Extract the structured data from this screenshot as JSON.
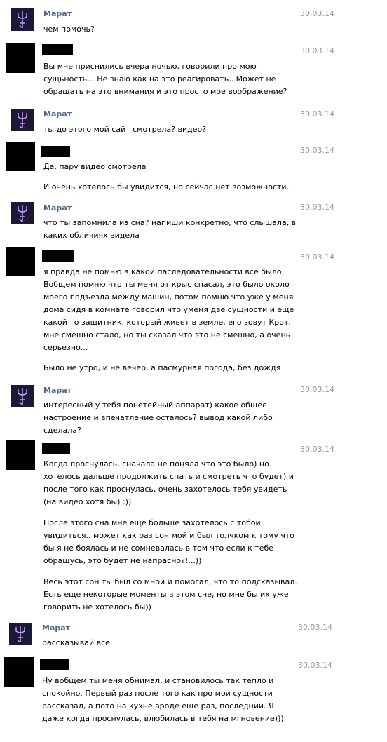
{
  "messages": [
    {
      "author": "Марат",
      "date": "30.03.14",
      "paragraphs": [
        "чем помочь?"
      ]
    },
    {
      "author": "",
      "date": "30.03.14",
      "paragraphs": [
        "Вы мне приснились вчера ночью, говорили про мою\nсущьность... Не знаю как на это реагировать.. Может не\nобращать на это внимания и это просто мое воображение?"
      ]
    },
    {
      "author": "Марат",
      "date": "30.03.14",
      "paragraphs": [
        "ты до этого мой сайт смотрела? видео?"
      ]
    },
    {
      "author": "",
      "date": "30.03.14",
      "paragraphs": [
        "Да, пару видео смотрела",
        "И очень хотелось бы увидится, но сейчас нет возможности.."
      ]
    },
    {
      "author": "Марат",
      "date": "30.03.14",
      "paragraphs": [
        "что ты запомнила из сна? напиши конкретно, что слышала, в\nкаких обличиях видела"
      ]
    },
    {
      "author": "",
      "date": "30.03.14",
      "paragraphs": [
        "я правда не помню в какой паследовательности все было.\nВобщем помню что ты меня от крыс спасал, это было около\nмоего подъезда между машин, потом помню что уже у меня\nдома сидя в комнате говорил что уменя две сущности и еще\nкакой то защитник, который живет в земле, его зовут Крот,\nмне смешно стало, но ты сказал что это не смешно, а очень\nсерьезно...",
        "Было не утро, и не вечер, а пасмурная погода, без дождя"
      ]
    },
    {
      "author": "Марат",
      "date": "30.03.14",
      "paragraphs": [
        "интересный у тебя понетейный аппарат) какое общее\nнастроение и впечатление осталось? вывод какой либо\nсделала?"
      ]
    },
    {
      "author": "",
      "date": "30.03.14",
      "paragraphs": [
        "Когда проснулась, сначала не поняла что это было) но\nхотелось дальше продолжить спать и смотреть что будет) и\nпосле того как проснулась, очень захотелось тебя увидеть\n(на видео хотя бы) :))",
        "После этого сна мне еще больше захотелось с тобой\nувидиться.. может как раз сон мой и был толчком к тому что\nбы я не боялась и не сомневалась в том что если к тебе\nобращусь, это будет не напрасно?!...))",
        "Весь этот сон ты был со мной и помогал, что то подсказывал.\nЕсть еще некоторые моменты в этом сне, но мне бы их уже\nговорить не хотелось бы))"
      ]
    },
    {
      "author": "Марат",
      "date": "30.03.14",
      "paragraphs": [
        "рассказывай всё"
      ]
    },
    {
      "author": "",
      "date": "30.03.14",
      "paragraphs": [
        "Ну вобщем ты меня обнимал, и становилось так тепло и\nспокойно. Первый раз после того как про мои сущности\nрассказал, а пото на кухне вроде еще раз, последний. Я\nдаже когда проснулась, влюбилась в тебя на мгновение)))"
      ]
    }
  ]
}
